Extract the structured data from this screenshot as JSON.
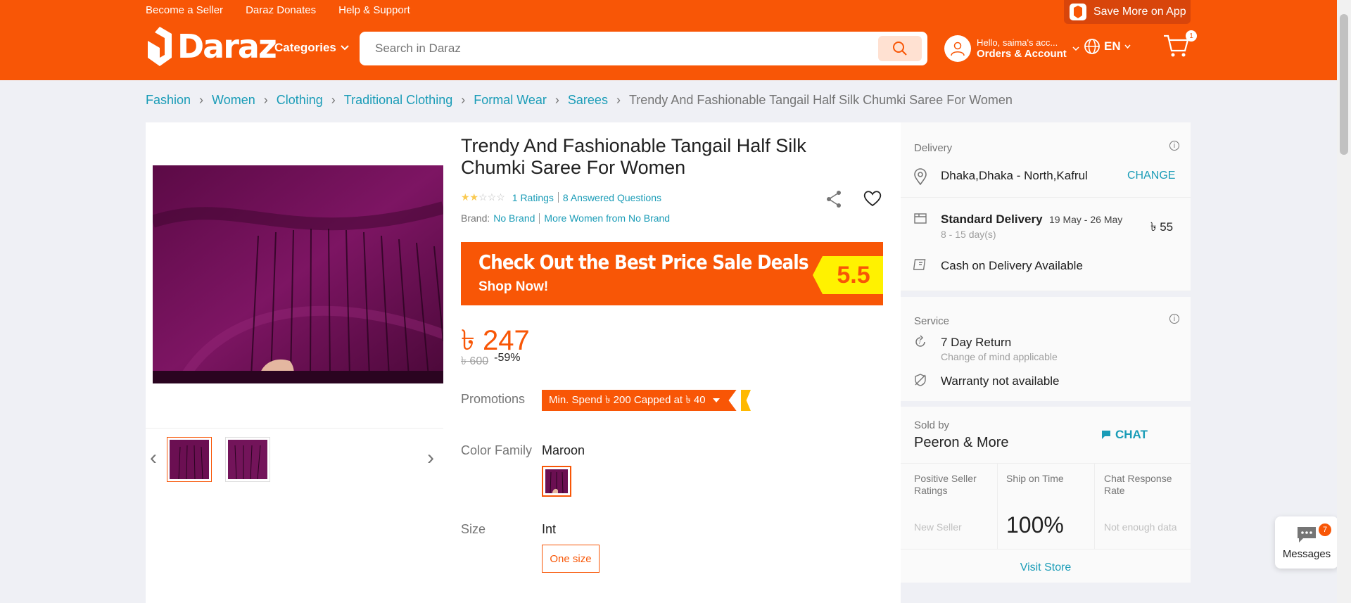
{
  "header": {
    "top_links": [
      "Become a Seller",
      "Daraz Donates",
      "Help & Support"
    ],
    "save_app": "Save More on App",
    "logo_text": "Daraz",
    "categories": "Categories",
    "search_placeholder": "Search in Daraz",
    "account_hello": "Hello, saima's acc...",
    "account_orders": "Orders & Account",
    "lang": "EN",
    "cart_count": "1"
  },
  "breadcrumb": {
    "items": [
      "Fashion",
      "Women",
      "Clothing",
      "Traditional Clothing",
      "Formal Wear",
      "Sarees"
    ],
    "current": "Trendy And Fashionable Tangail Half Silk Chumki Saree For Women"
  },
  "product": {
    "title": "Trendy And Fashionable Tangail Half Silk Chumki Saree For Women",
    "rating_stars": 2,
    "ratings_text": "1 Ratings",
    "questions_text": "8 Answered Questions",
    "brand_label": "Brand:",
    "brand": "No Brand",
    "more_from": "More Women from No Brand",
    "banner_line1": "Check Out the Best Price Sale Deals",
    "banner_line2": "Shop Now!",
    "banner_tag": "5.5",
    "price": "৳ 247",
    "original_price": "৳ 600",
    "discount": "-59%",
    "promotions_label": "Promotions",
    "promo_text": "Min. Spend ৳ 200 Capped at ৳ 40",
    "color_label": "Color Family",
    "color_value": "Maroon",
    "size_label": "Size",
    "size_value": "Int",
    "size_option": "One size",
    "colors": {
      "accent": "#f85606",
      "link": "#1a9cb7",
      "fabric": "#6b0f52"
    }
  },
  "delivery": {
    "label": "Delivery",
    "location": "Dhaka,Dhaka - North,Kafrul",
    "change": "CHANGE",
    "standard": "Standard Delivery",
    "dates": "19 May - 26 May",
    "days": "8 - 15 day(s)",
    "fee": "৳ 55",
    "cod": "Cash on Delivery Available"
  },
  "service": {
    "label": "Service",
    "return_title": "7 Day Return",
    "return_sub": "Change of mind applicable",
    "warranty": "Warranty not available"
  },
  "seller": {
    "sold_by": "Sold by",
    "name": "Peeron & More",
    "chat": "CHAT",
    "metrics": [
      {
        "label": "Positive Seller Ratings",
        "value": "New Seller"
      },
      {
        "label": "Ship on Time",
        "value": "100%"
      },
      {
        "label": "Chat Response Rate",
        "value": "Not enough data"
      }
    ],
    "visit": "Visit Store"
  },
  "messages": {
    "label": "Messages",
    "count": "7"
  }
}
